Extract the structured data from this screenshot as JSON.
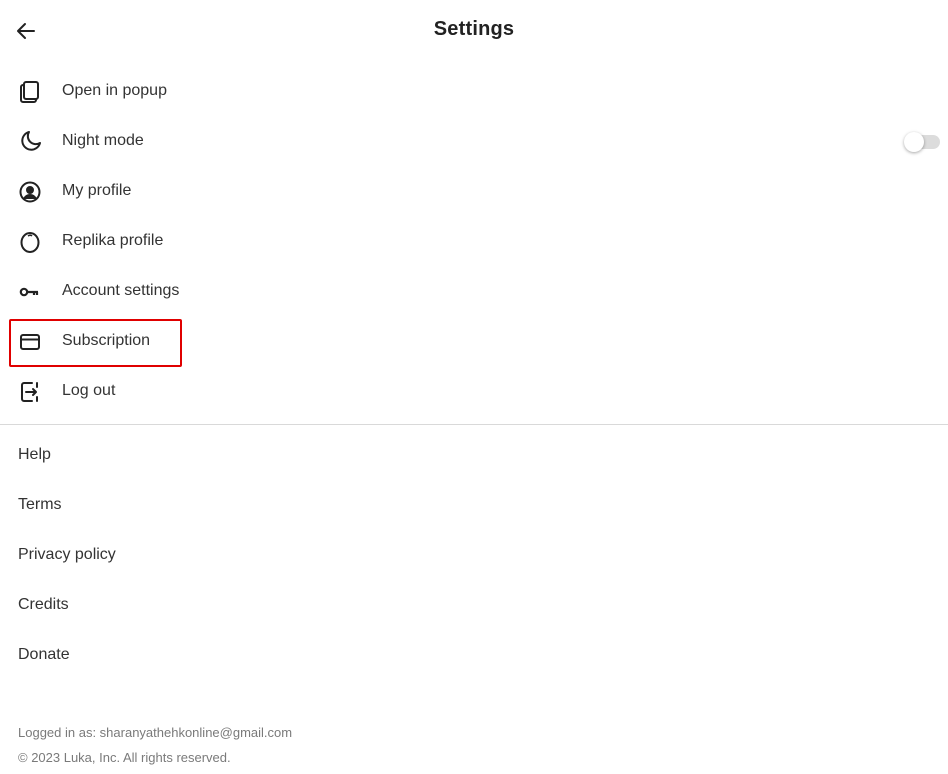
{
  "header": {
    "title": "Settings",
    "back_icon": "arrow-left-icon"
  },
  "menu": {
    "items": [
      {
        "label": "Open in popup",
        "icon": "copy-pages-icon"
      },
      {
        "label": "Night mode",
        "icon": "moon-icon",
        "toggle": false
      },
      {
        "label": "My profile",
        "icon": "user-circle-icon"
      },
      {
        "label": "Replika profile",
        "icon": "egg-icon"
      },
      {
        "label": "Account settings",
        "icon": "key-icon"
      },
      {
        "label": "Subscription",
        "icon": "credit-card-icon",
        "highlighted": true
      },
      {
        "label": "Log out",
        "icon": "logout-icon"
      }
    ]
  },
  "links": [
    {
      "label": "Help"
    },
    {
      "label": "Terms"
    },
    {
      "label": "Privacy policy"
    },
    {
      "label": "Credits"
    },
    {
      "label": "Donate"
    }
  ],
  "footer": {
    "logged_in": "Logged in as: sharanyathehkonline@gmail.com",
    "copyright": "© 2023 Luka, Inc. All rights reserved."
  },
  "colors": {
    "highlight": "#e00000",
    "divider": "#d9d9d9",
    "toggle_track": "#dcdcdc"
  }
}
